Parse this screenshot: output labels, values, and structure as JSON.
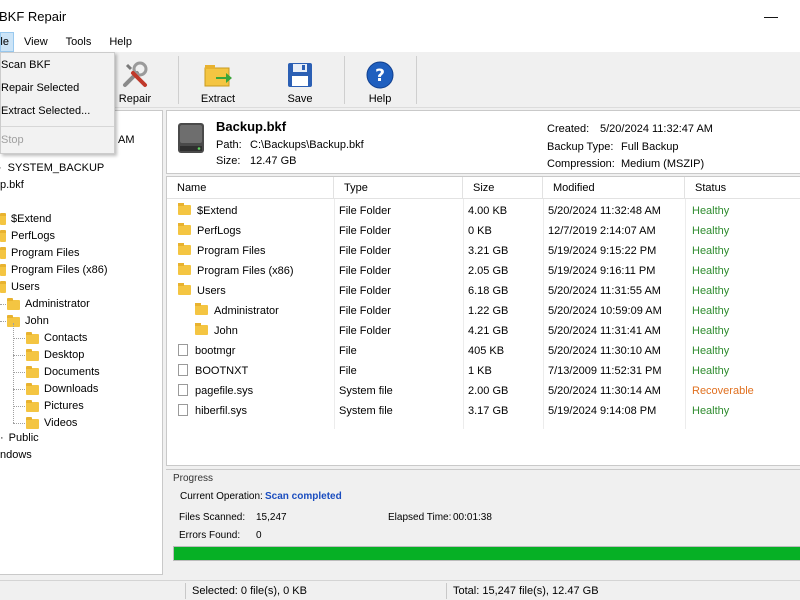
{
  "window": {
    "title": "BKF Repair",
    "minimize_glyph": "—"
  },
  "menu": {
    "file": "File",
    "view": "View",
    "tools": "Tools",
    "help": "Help"
  },
  "dropdown": {
    "items": [
      "Scan BKF",
      "Repair Selected",
      "Extract Selected..."
    ],
    "disabled_item": "Stop"
  },
  "toolbar": {
    "repair": "Repair",
    "extract": "Extract",
    "save": "Save",
    "help": "Help"
  },
  "tree": {
    "nodes": [
      "AM",
      "SYSTEM_BACKUP",
      "p.bkf",
      "$Extend",
      "PerfLogs",
      "Program Files",
      "Program Files (x86)",
      "Users",
      "Administrator",
      "John",
      "Contacts",
      "Desktop",
      "Documents",
      "Downloads",
      "Pictures",
      "Videos",
      "Public",
      "ndows"
    ]
  },
  "info": {
    "file_name": "Backup.bkf",
    "path_label": "Path:",
    "path": "C:\\Backups\\Backup.bkf",
    "size_label": "Size:",
    "size": "12.47 GB",
    "created_label": "Created:",
    "created": "5/20/2024 11:32:47 AM",
    "type_label": "Backup Type:",
    "type": "Full Backup",
    "compression_label": "Compression:",
    "compression": "Medium (MSZIP)"
  },
  "list": {
    "headers": {
      "name": "Name",
      "type": "Type",
      "size": "Size",
      "modified": "Modified",
      "status": "Status"
    },
    "rows": [
      {
        "name": "$Extend",
        "type": "File Folder",
        "size": "4.00 KB",
        "modified": "5/20/2024 11:32:48 AM",
        "status": "Healthy"
      },
      {
        "name": "PerfLogs",
        "type": "File Folder",
        "size": "0 KB",
        "modified": "12/7/2019 2:14:07 AM",
        "status": "Healthy"
      },
      {
        "name": "Program Files",
        "type": "File Folder",
        "size": "3.21 GB",
        "modified": "5/19/2024 9:15:22 PM",
        "status": "Healthy"
      },
      {
        "name": "Program Files (x86)",
        "type": "File Folder",
        "size": "2.05 GB",
        "modified": "5/19/2024 9:16:11 PM",
        "status": "Healthy"
      },
      {
        "name": "Users",
        "type": "File Folder",
        "size": "6.18 GB",
        "modified": "5/20/2024 11:31:55 AM",
        "status": "Healthy"
      },
      {
        "name": "Administrator",
        "type": "File Folder",
        "size": "1.22 GB",
        "modified": "5/20/2024 10:59:09 AM",
        "status": "Healthy"
      },
      {
        "name": "John",
        "type": "File Folder",
        "size": "4.21 GB",
        "modified": "5/20/2024 11:31:41 AM",
        "status": "Healthy"
      },
      {
        "name": "bootmgr",
        "type": "File",
        "size": "405 KB",
        "modified": "5/20/2024 11:30:10 AM",
        "status": "Healthy"
      },
      {
        "name": "BOOTNXT",
        "type": "File",
        "size": "1 KB",
        "modified": "7/13/2009 11:52:31 PM",
        "status": "Healthy"
      },
      {
        "name": "pagefile.sys",
        "type": "System file",
        "size": "2.00 GB",
        "modified": "5/20/2024 11:30:14 AM",
        "status": "Recoverable"
      },
      {
        "name": "hiberfil.sys",
        "type": "System file",
        "size": "3.17 GB",
        "modified": "5/19/2024 9:14:08 PM",
        "status": "Healthy"
      }
    ]
  },
  "progress": {
    "title": "Progress",
    "op_label": "Current Operation:",
    "op_value": "Scan completed",
    "files_label": "Files Scanned:",
    "files_value": "15,247",
    "elapsed_label": "Elapsed Time:",
    "elapsed_value": "00:01:38",
    "errors_label": "Errors Found:",
    "errors_value": "0",
    "percent": 100
  },
  "status": {
    "selected": "Selected: 0 file(s), 0 KB",
    "total": "Total: 15,247 file(s), 12.47 GB"
  },
  "colors": {
    "healthy": "#2e8b2e",
    "recoverable": "#e07020",
    "progress": "#06b025",
    "operation": "#1a4dbf"
  }
}
